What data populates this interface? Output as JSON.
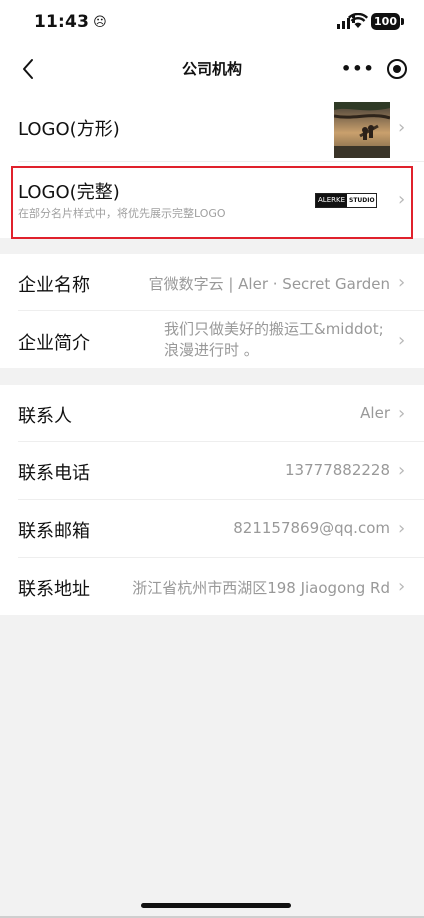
{
  "status": {
    "time": "11:43",
    "emoji": "☹",
    "battery": "100"
  },
  "nav": {
    "title": "公司机构",
    "more": "•••"
  },
  "logo_group": {
    "square": {
      "label": "LOGO(方形)"
    },
    "full": {
      "label": "LOGO(完整)",
      "hint": "在部分名片样式中，将优先展示完整LOGO",
      "logo_left": "ALERKE",
      "logo_right": "STUDIO"
    }
  },
  "company": {
    "name": {
      "label": "企业名称",
      "value": "官微数字云 | Aler · Secret Garden"
    },
    "intro": {
      "label": "企业简介",
      "value_line1": "我们只做美好的搬运工&middot;",
      "value_line2": "浪漫进行时 。"
    }
  },
  "contact": {
    "person": {
      "label": "联系人",
      "value": "Aler"
    },
    "phone": {
      "label": "联系电话",
      "value": "13777882228"
    },
    "email": {
      "label": "联系邮箱",
      "value": "821157869@qq.com"
    },
    "address": {
      "label": "联系地址",
      "value": "浙江省杭州市西湖区198 Jiaogong Rd"
    }
  },
  "icons": {
    "chevron": "›"
  }
}
